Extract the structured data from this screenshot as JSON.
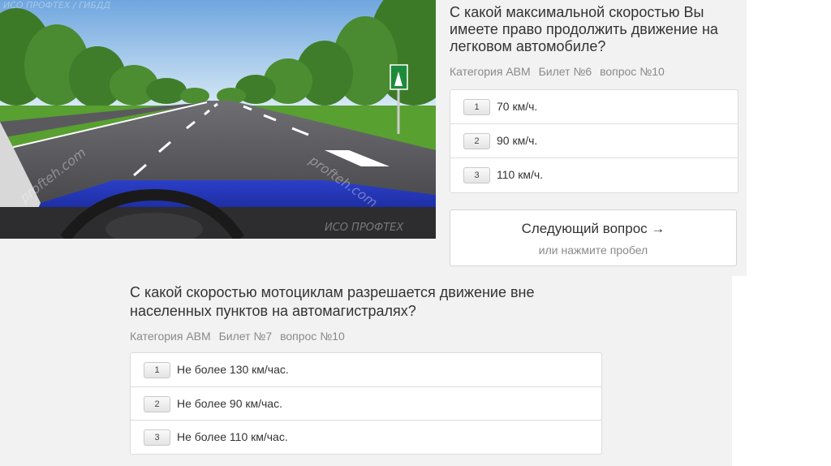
{
  "scene": {
    "top_watermark": "ИСО ПРОФТЕХ / ГИБДД",
    "diagonal_watermark_1": "profteh.com",
    "diagonal_watermark_2": "profteh.com",
    "bottom_watermark": "ИСО ПРОФТЕХ"
  },
  "question1": {
    "title": "С какой максимальной скоростью Вы имеете право продолжить движение на легковом автомобиле?",
    "category": "Категория АВМ",
    "ticket": "Билет №6",
    "question_no": "вопрос №10",
    "answers": [
      {
        "num": "1",
        "text": "70 км/ч."
      },
      {
        "num": "2",
        "text": "90 км/ч."
      },
      {
        "num": "3",
        "text": "110 км/ч."
      }
    ]
  },
  "next": {
    "label": "Следующий вопрос →",
    "hint": "или нажмите пробел"
  },
  "question2": {
    "title": "С какой скоростью мотоциклам разрешается движение вне населенных пунктов на автомагистралях?",
    "category": "Категория АВМ",
    "ticket": "Билет №7",
    "question_no": "вопрос №10",
    "answers": [
      {
        "num": "1",
        "text": "Не более 130 км/час."
      },
      {
        "num": "2",
        "text": "Не более 90 км/час."
      },
      {
        "num": "3",
        "text": "Не более 110 км/час."
      }
    ]
  },
  "colors": {
    "sign": "#1e8a3c",
    "hood": "#1a2a9a",
    "grass": "#4c8f2a"
  }
}
